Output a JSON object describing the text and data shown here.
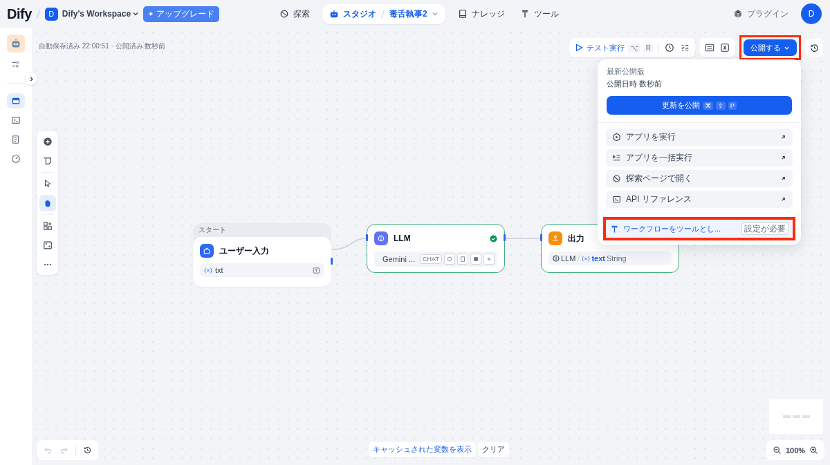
{
  "header": {
    "logo": "Dify",
    "workspace": {
      "avatar": "D",
      "name": "Dify's Workspace"
    },
    "upgrade": "アップグレード",
    "nav": [
      {
        "label": "探索",
        "selected": false
      },
      {
        "label": "スタジオ",
        "selected": true,
        "app": "毒舌執事2"
      },
      {
        "label": "ナレッジ",
        "selected": false
      },
      {
        "label": "ツール",
        "selected": false
      }
    ],
    "plugins": "プラグイン",
    "user_avatar": "D"
  },
  "sidebar": {
    "items": [
      {
        "selected": false
      },
      {
        "selected": false
      },
      {
        "selected": true
      },
      {
        "selected": false
      },
      {
        "selected": false
      },
      {
        "selected": false
      }
    ]
  },
  "status": "自動保存済み 22:00:51 · 公開済み 数秒前",
  "toolbar": {
    "test_run": {
      "label": "テスト実行",
      "keys": [
        "⌥",
        "R"
      ]
    },
    "publish": {
      "label": "公開する",
      "highlighted": true
    }
  },
  "publish_menu": {
    "heading": "最新公開版",
    "time": "公開日時 数秒前",
    "update": {
      "label": "更新を公開",
      "keys": [
        "⌘",
        "⇧",
        "P"
      ]
    },
    "items": [
      {
        "label": "アプリを実行"
      },
      {
        "label": "アプリを一括実行"
      },
      {
        "label": "探索ページで開く"
      },
      {
        "label": "API リファレンス"
      }
    ],
    "tool_item": {
      "label": "ワークフローをツールとし...",
      "badge": "設定が必要",
      "highlighted": true
    }
  },
  "canvas_tools": [
    {
      "selected": false
    },
    {
      "selected": false
    },
    {
      "selected": false
    },
    {
      "selected": true
    },
    {
      "selected": false
    },
    {
      "selected": false
    },
    {
      "selected": false
    }
  ],
  "nodes": [
    {
      "kind": "start",
      "header": "スタート",
      "title": "ユーザー入力",
      "variable": "txt"
    },
    {
      "kind": "llm",
      "title": "LLM",
      "model": "Gemini ...",
      "mode": "CHAT",
      "valid": true
    },
    {
      "kind": "output",
      "title": "出力",
      "source": "LLM",
      "variable": "text",
      "type": "String"
    }
  ],
  "bottom": {
    "cache": "キャッシュされた変数を表示",
    "clear": "クリア",
    "zoom": "100%"
  }
}
